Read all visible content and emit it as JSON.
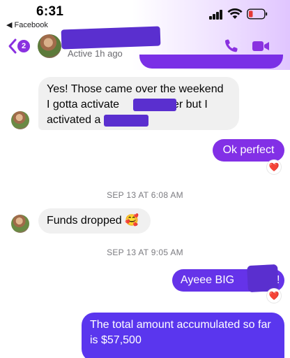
{
  "status_bar": {
    "time": "6:31",
    "back_app": "◀ Facebook"
  },
  "header": {
    "back_count": "2",
    "active_status": "Active 1h ago",
    "accent_color": "#8a31e0"
  },
  "messages": {
    "m1_line1": "Yes! Those came over the weekend",
    "m1_line2a": "I gotta activate",
    "m1_line2b": "ver but I",
    "m1_line3a": "activated a",
    "m2": "Ok perfect",
    "m2_reaction": "❤️",
    "ts1": "SEP 13 AT 6:08 AM",
    "m3": "Funds dropped 🥰",
    "ts2": "SEP 13 AT 9:05 AM",
    "m4": "Ayeee BIG",
    "m4_end": "!",
    "m4_reaction": "❤️",
    "m5": "The total amount accumulated so far is $57,500"
  },
  "colors": {
    "outgoing_bubble": "#6533e9",
    "incoming_bubble": "#f0f0f0",
    "redaction": "#5a2fcf"
  }
}
